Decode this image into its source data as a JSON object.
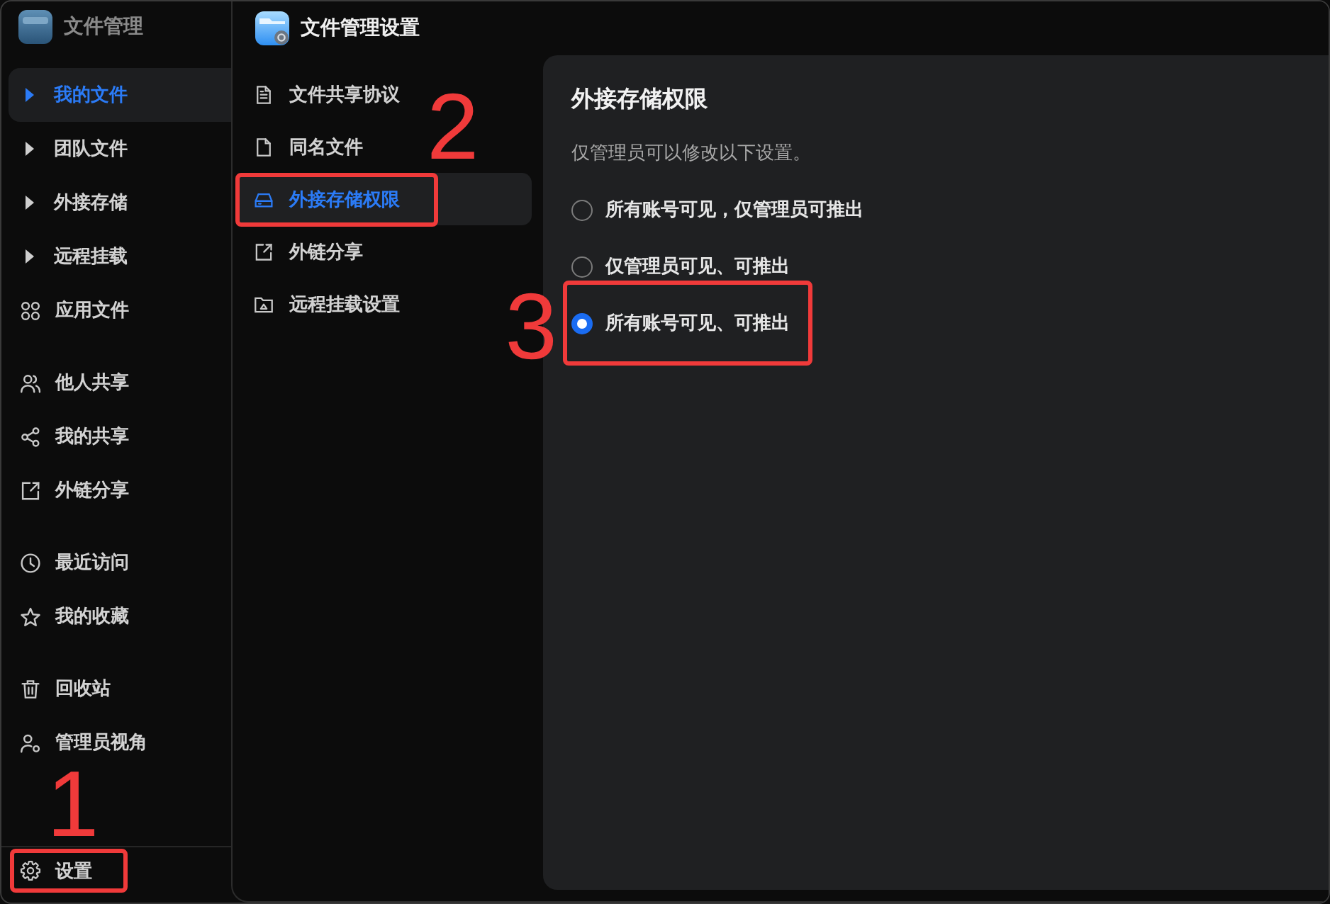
{
  "app": {
    "title": "文件管理"
  },
  "sidebar": {
    "sections": [
      {
        "items": [
          {
            "label": "我的文件",
            "kind": "tree",
            "expanded": false,
            "selected": true
          },
          {
            "label": "团队文件",
            "kind": "tree",
            "expanded": false,
            "selected": false
          },
          {
            "label": "外接存储",
            "kind": "tree",
            "expanded": false,
            "selected": false
          },
          {
            "label": "远程挂载",
            "kind": "tree",
            "expanded": false,
            "selected": false
          },
          {
            "label": "应用文件",
            "kind": "entry",
            "selected": false
          }
        ]
      },
      {
        "items": [
          {
            "label": "他人共享",
            "kind": "entry",
            "selected": false
          },
          {
            "label": "我的共享",
            "kind": "entry",
            "selected": false
          },
          {
            "label": "外链分享",
            "kind": "entry",
            "selected": false
          }
        ]
      },
      {
        "items": [
          {
            "label": "最近访问",
            "kind": "entry",
            "selected": false
          },
          {
            "label": "我的收藏",
            "kind": "entry",
            "selected": false
          }
        ]
      },
      {
        "items": [
          {
            "label": "回收站",
            "kind": "entry",
            "selected": false
          },
          {
            "label": "管理员视角",
            "kind": "entry",
            "selected": false
          }
        ]
      }
    ],
    "footer": {
      "label": "设置",
      "annotation": "1"
    }
  },
  "settings": {
    "title": "文件管理设置",
    "nav": [
      {
        "label": "文件共享协议",
        "selected": false
      },
      {
        "label": "同名文件",
        "selected": false
      },
      {
        "label": "外接存储权限",
        "selected": true,
        "annotation": "2"
      },
      {
        "label": "外链分享",
        "selected": false
      },
      {
        "label": "远程挂载设置",
        "selected": false
      }
    ],
    "panel": {
      "heading": "外接存储权限",
      "note": "仅管理员可以修改以下设置。",
      "options": [
        {
          "label": "所有账号可见，仅管理员可推出",
          "selected": false
        },
        {
          "label": "仅管理员可见、可推出",
          "selected": false
        },
        {
          "label": "所有账号可见、可推出",
          "selected": true,
          "annotation": "3"
        }
      ]
    }
  }
}
